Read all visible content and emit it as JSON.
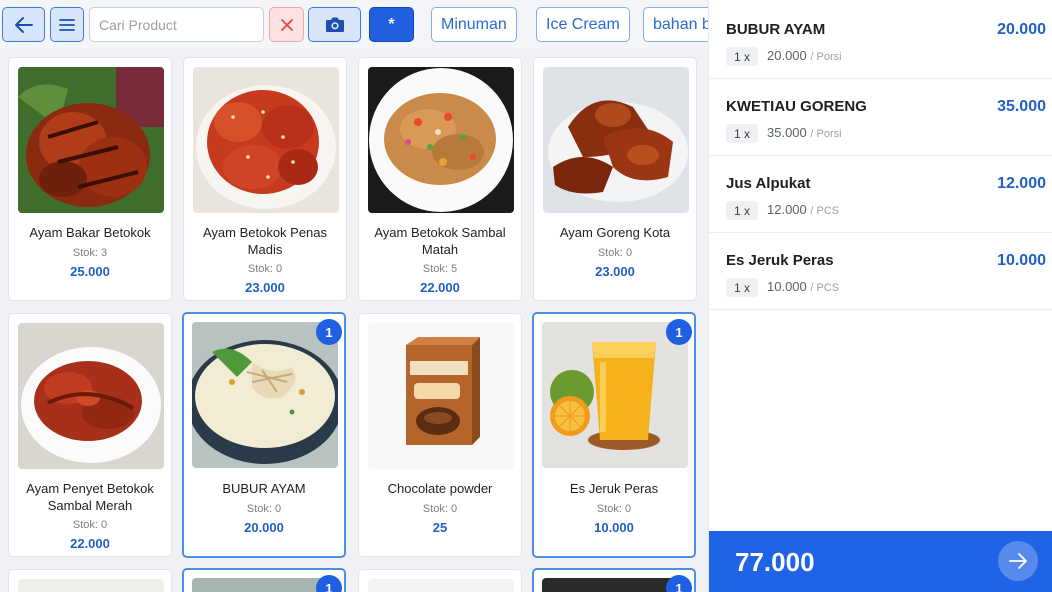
{
  "search": {
    "placeholder": "Cari Product"
  },
  "toolbar": {
    "all_label": "*"
  },
  "categories": [
    "Minuman",
    "Ice Cream",
    "bahan baku"
  ],
  "products": [
    {
      "name": "Ayam Bakar Betokok",
      "stock": "Stok: 3",
      "price": "25.000",
      "badge": ""
    },
    {
      "name": "Ayam Betokok Penas Madis",
      "stock": "Stok: 0",
      "price": "23.000",
      "badge": ""
    },
    {
      "name": "Ayam Betokok Sambal Matah",
      "stock": "Stok: 5",
      "price": "22.000",
      "badge": ""
    },
    {
      "name": "Ayam Goreng Kota",
      "stock": "Stok: 0",
      "price": "23.000",
      "badge": ""
    },
    {
      "name": "Ayam Penyet Betokok Sambal Merah",
      "stock": "Stok: 0",
      "price": "22.000",
      "badge": ""
    },
    {
      "name": "BUBUR AYAM",
      "stock": "Stok: 0",
      "price": "20.000",
      "badge": "1"
    },
    {
      "name": "Chocolate powder",
      "stock": "Stok: 0",
      "price": "25",
      "badge": ""
    },
    {
      "name": "Es Jeruk Peras",
      "stock": "Stok: 0",
      "price": "10.000",
      "badge": "1"
    }
  ],
  "row3_badges": [
    "1",
    "1"
  ],
  "order": [
    {
      "name": "BUBUR AYAM",
      "qty": "1 x",
      "unit_price": "20.000",
      "unit": "/ Porsi",
      "total": "20.000"
    },
    {
      "name": "KWETIAU GORENG",
      "qty": "1 x",
      "unit_price": "35.000",
      "unit": "/ Porsi",
      "total": "35.000"
    },
    {
      "name": "Jus Alpukat",
      "qty": "1 x",
      "unit_price": "12.000",
      "unit": "/ PCS",
      "total": "12.000"
    },
    {
      "name": "Es Jeruk Peras",
      "qty": "1 x",
      "unit_price": "10.000",
      "unit": "/ PCS",
      "total": "10.000"
    }
  ],
  "checkout": {
    "total": "77.000"
  },
  "colors": {
    "accent": "#1f5fe0",
    "price": "#2060c8",
    "danger": "#e04848"
  }
}
